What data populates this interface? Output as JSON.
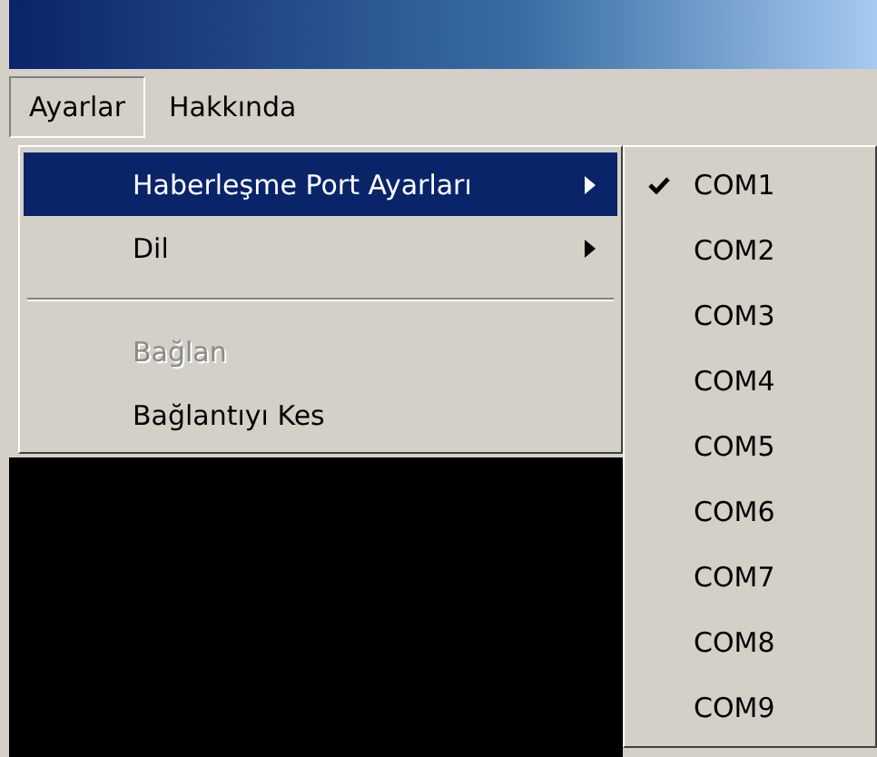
{
  "menu_bar": [
    {
      "label": "Ayarlar",
      "selected": true
    },
    {
      "label": "Hakkında",
      "selected": false
    }
  ],
  "menu": [
    {
      "kind": "item",
      "label": "Haberleşme Port Ayarları",
      "has_submenu": true,
      "selected": true,
      "disabled": false
    },
    {
      "kind": "item",
      "label": "Dil",
      "has_submenu": true,
      "selected": false,
      "disabled": false
    },
    {
      "kind": "separator"
    },
    {
      "kind": "item",
      "label": "Bağlan",
      "has_submenu": false,
      "selected": false,
      "disabled": true
    },
    {
      "kind": "item",
      "label": "Bağlantıyı Kes",
      "has_submenu": false,
      "selected": false,
      "disabled": false
    }
  ],
  "submenu": [
    {
      "label": "COM1",
      "checked": true
    },
    {
      "label": "COM2",
      "checked": false
    },
    {
      "label": "COM3",
      "checked": false
    },
    {
      "label": "COM4",
      "checked": false
    },
    {
      "label": "COM5",
      "checked": false
    },
    {
      "label": "COM6",
      "checked": false
    },
    {
      "label": "COM7",
      "checked": false
    },
    {
      "label": "COM8",
      "checked": false
    },
    {
      "label": "COM9",
      "checked": false
    }
  ]
}
